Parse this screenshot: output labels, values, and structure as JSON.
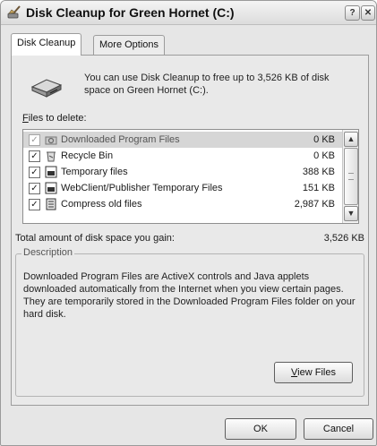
{
  "window": {
    "title": "Disk Cleanup for Green Hornet (C:)",
    "help_glyph": "?",
    "close_glyph": "✕"
  },
  "tabs": [
    {
      "label": "Disk Cleanup",
      "active": true
    },
    {
      "label": "More Options",
      "active": false
    }
  ],
  "intro_text": "You can use Disk Cleanup to free up to 3,526 KB of disk space on Green Hornet (C:).",
  "files_label": {
    "accel": "F",
    "rest": "iles to delete:"
  },
  "files": [
    {
      "name": "Downloaded Program Files",
      "size": "0 KB",
      "checked": true,
      "selected": true,
      "icon": "folder-gear-icon"
    },
    {
      "name": "Recycle Bin",
      "size": "0 KB",
      "checked": true,
      "selected": false,
      "icon": "recycle-bin-icon"
    },
    {
      "name": "Temporary files",
      "size": "388 KB",
      "checked": true,
      "selected": false,
      "icon": "file-icon"
    },
    {
      "name": "WebClient/Publisher Temporary Files",
      "size": "151 KB",
      "checked": true,
      "selected": false,
      "icon": "file-icon"
    },
    {
      "name": "Compress old files",
      "size": "2,987 KB",
      "checked": true,
      "selected": false,
      "icon": "compress-icon"
    }
  ],
  "total": {
    "label": "Total amount of disk space you gain:",
    "value": "3,526 KB"
  },
  "description": {
    "title": "Description",
    "text": "Downloaded Program Files are ActiveX controls and Java applets downloaded automatically from the Internet when you view certain pages. They are temporarily stored in the Downloaded Program Files folder on your hard disk."
  },
  "buttons": {
    "view_files": {
      "accel": "V",
      "rest": "iew Files"
    },
    "ok": "OK",
    "cancel": "Cancel"
  },
  "scroll": {
    "up": "▲",
    "down": "▼"
  }
}
